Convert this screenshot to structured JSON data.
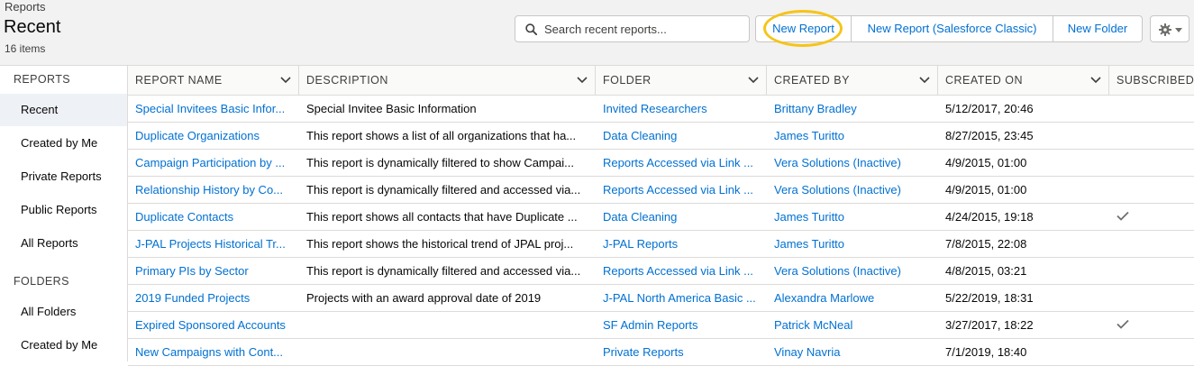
{
  "header": {
    "eyebrow": "Reports",
    "title": "Recent",
    "count": "16 items",
    "search_placeholder": "Search recent reports...",
    "buttons": [
      "New Report",
      "New Report (Salesforce Classic)",
      "New Folder"
    ],
    "highlight_color": "#f5c518"
  },
  "sidebar": {
    "reports_heading": "REPORTS",
    "report_items": [
      "Recent",
      "Created by Me",
      "Private Reports",
      "Public Reports",
      "All Reports"
    ],
    "folders_heading": "FOLDERS",
    "folder_items": [
      "All Folders",
      "Created by Me"
    ],
    "active_item": "Recent"
  },
  "table": {
    "columns": [
      "REPORT NAME",
      "DESCRIPTION",
      "FOLDER",
      "CREATED BY",
      "CREATED ON",
      "SUBSCRIBED"
    ],
    "rows": [
      {
        "name": "Special Invitees Basic Infor...",
        "description": "Special Invitee Basic Information",
        "folder": "Invited Researchers",
        "created_by": "Brittany Bradley",
        "created_on": "5/12/2017, 20:46",
        "subscribed": false
      },
      {
        "name": "Duplicate Organizations",
        "description": "This report shows a list of all organizations that ha...",
        "folder": "Data Cleaning",
        "created_by": "James Turitto",
        "created_on": "8/27/2015, 23:45",
        "subscribed": false
      },
      {
        "name": "Campaign Participation by ...",
        "description": "This report is dynamically filtered to show Campai...",
        "folder": "Reports Accessed via Link ...",
        "created_by": "Vera Solutions (Inactive)",
        "created_on": "4/9/2015, 01:00",
        "subscribed": false
      },
      {
        "name": "Relationship History by Co...",
        "description": "This report is dynamically filtered and accessed via...",
        "folder": "Reports Accessed via Link ...",
        "created_by": "Vera Solutions (Inactive)",
        "created_on": "4/9/2015, 01:00",
        "subscribed": false
      },
      {
        "name": "Duplicate Contacts",
        "description": "This report shows all contacts that have Duplicate ...",
        "folder": "Data Cleaning",
        "created_by": "James Turitto",
        "created_on": "4/24/2015, 19:18",
        "subscribed": true
      },
      {
        "name": "J-PAL Projects Historical Tr...",
        "description": "This report shows the historical trend of JPAL proj...",
        "folder": "J-PAL Reports",
        "created_by": "James Turitto",
        "created_on": "7/8/2015, 22:08",
        "subscribed": false
      },
      {
        "name": "Primary PIs by Sector",
        "description": "This report is dynamically filtered and accessed via...",
        "folder": "Reports Accessed via Link ...",
        "created_by": "Vera Solutions (Inactive)",
        "created_on": "4/8/2015, 03:21",
        "subscribed": false
      },
      {
        "name": "2019 Funded Projects",
        "description": "Projects with an award approval date of 2019",
        "folder": "J-PAL North America Basic ...",
        "created_by": "Alexandra Marlowe",
        "created_on": "5/22/2019, 18:31",
        "subscribed": false
      },
      {
        "name": "Expired Sponsored Accounts",
        "description": "",
        "folder": "SF Admin Reports",
        "created_by": "Patrick McNeal",
        "created_on": "3/27/2017, 18:22",
        "subscribed": true
      },
      {
        "name": "New Campaigns with Cont...",
        "description": "",
        "folder": "Private Reports",
        "created_by": "Vinay Navria",
        "created_on": "7/1/2019, 18:40",
        "subscribed": false
      }
    ]
  }
}
